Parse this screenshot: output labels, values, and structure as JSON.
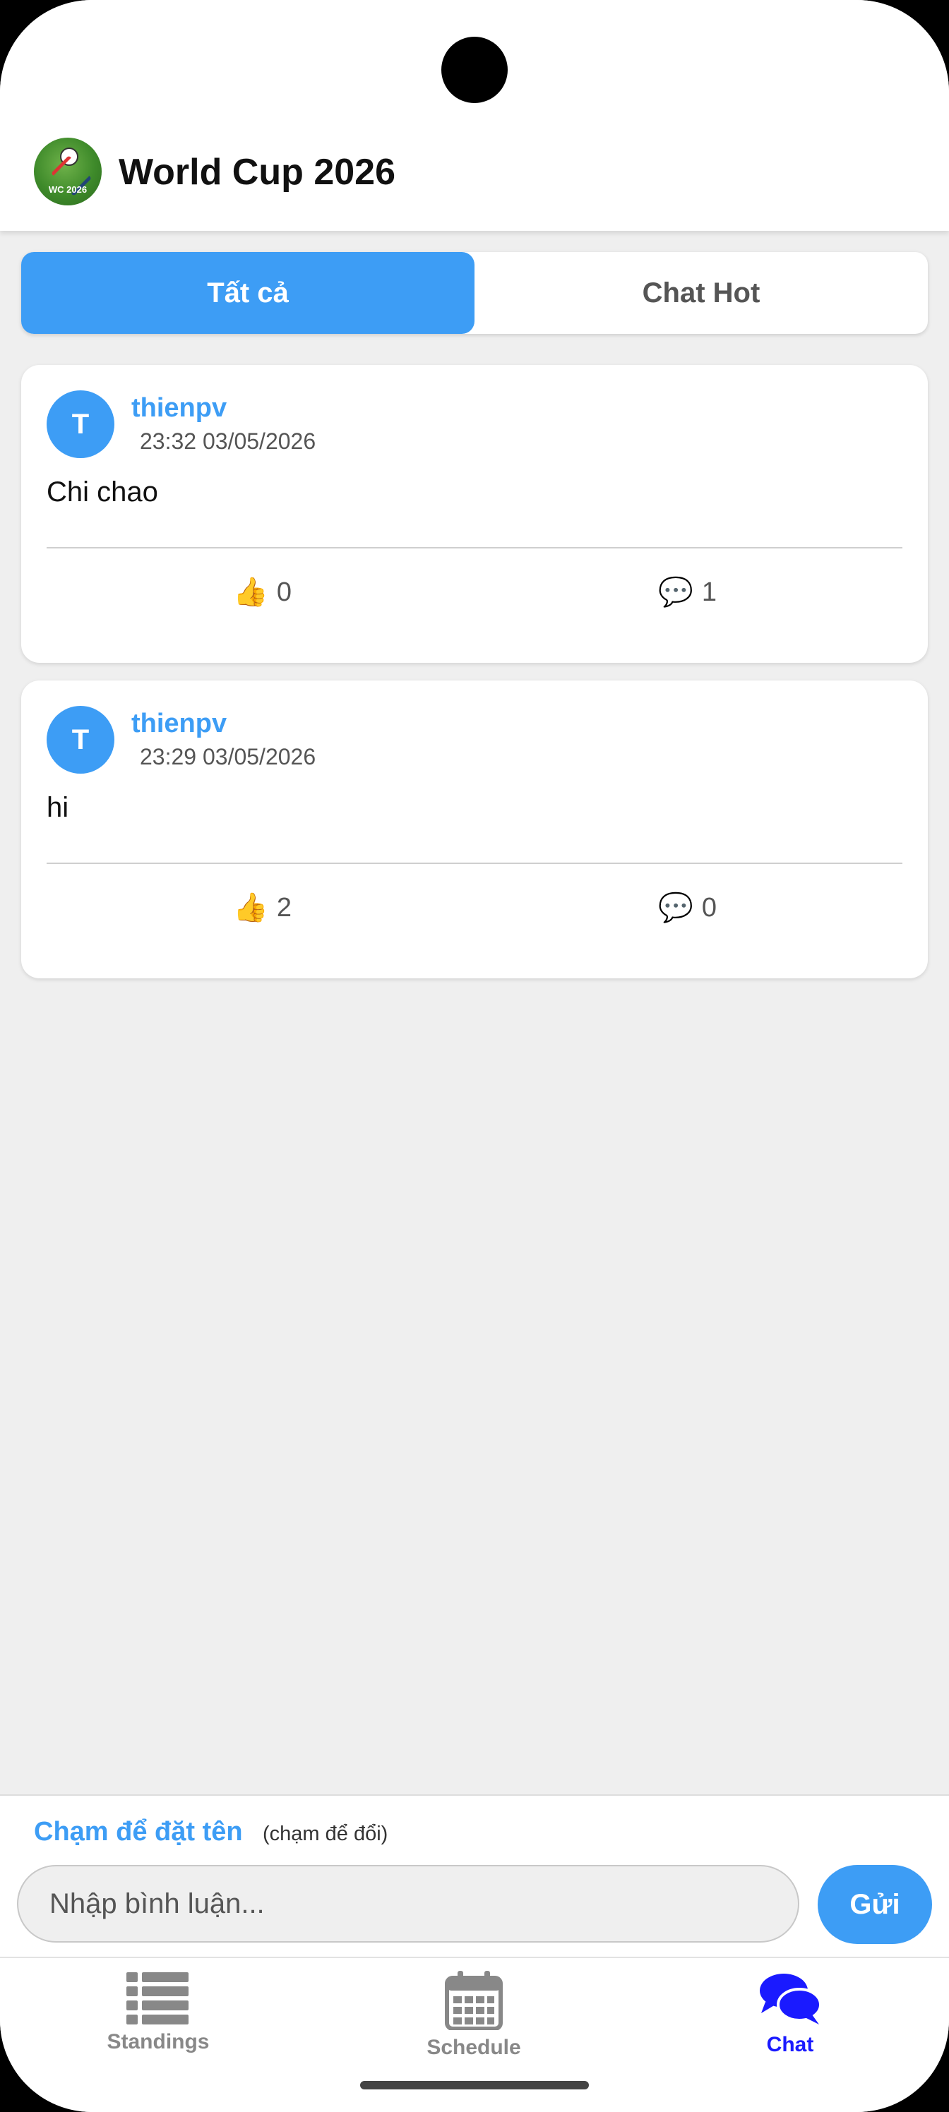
{
  "app": {
    "title": "World Cup 2026",
    "logo_text": "WC 2026"
  },
  "tabs": [
    {
      "label": "Tất cả",
      "active": true
    },
    {
      "label": "Chat Hot",
      "active": false
    }
  ],
  "posts": [
    {
      "avatar_letter": "T",
      "author": "thienpv",
      "time": "23:32 03/05/2026",
      "message": "Chi chao",
      "likes": "0",
      "comments": "1"
    },
    {
      "avatar_letter": "T",
      "author": "thienpv",
      "time": "23:29 03/05/2026",
      "message": "hi",
      "likes": "2",
      "comments": "0"
    }
  ],
  "composer": {
    "name_link": "Chạm để đặt tên",
    "name_hint": "(chạm để đổi)",
    "placeholder": "Nhập bình luận...",
    "send_label": "Gửi"
  },
  "bottom_nav": [
    {
      "label": "Standings",
      "icon": "list-icon",
      "active": false
    },
    {
      "label": "Schedule",
      "icon": "calendar-icon",
      "active": false
    },
    {
      "label": "Chat",
      "icon": "chat-bubbles-icon",
      "active": true
    }
  ],
  "colors": {
    "accent": "#3d9df5",
    "nav_active": "#1a1aff",
    "nav_inactive": "#888888",
    "background": "#efefef"
  }
}
